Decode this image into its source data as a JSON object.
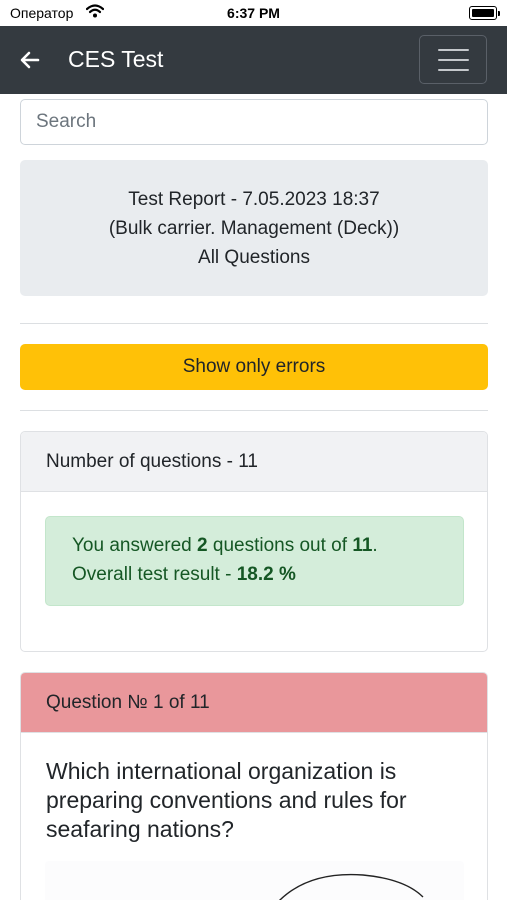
{
  "status_bar": {
    "carrier": "Оператор",
    "time": "6:37 PM"
  },
  "navbar": {
    "title": "CES Test"
  },
  "search": {
    "placeholder": "Search"
  },
  "report": {
    "line1": "Test Report - 7.05.2023 18:37",
    "line2": "(Bulk carrier. Management (Deck))",
    "line3": "All Questions"
  },
  "filter_button": {
    "label": "Show only errors"
  },
  "summary": {
    "header": "Number of questions - 11",
    "answered_prefix": "You answered ",
    "answered_count": "2",
    "answered_middle": " questions out of ",
    "total_count": "11",
    "answered_suffix": ".",
    "result_prefix": "Overall test result - ",
    "result_value": "18.2 %"
  },
  "question": {
    "header": "Question № 1 of 11",
    "text": "Which international organization is preparing conventions and rules for seafaring nations?"
  },
  "colors": {
    "navbar": "#343a40",
    "warning": "#ffc107",
    "success_bg": "#d4edda",
    "success_text": "#155724",
    "error_header": "#e9979b"
  }
}
